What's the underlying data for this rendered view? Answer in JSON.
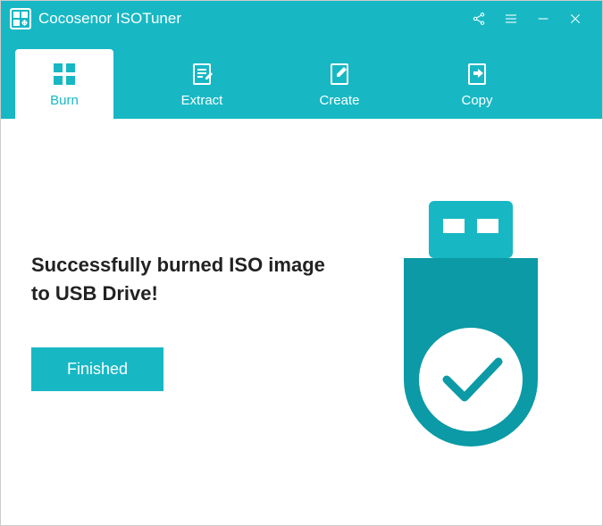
{
  "app": {
    "title": "Cocosenor ISOTuner"
  },
  "tabs": {
    "burn": "Burn",
    "extract": "Extract",
    "create": "Create",
    "copy": "Copy"
  },
  "main": {
    "message": "Successfully burned ISO image to USB Drive!",
    "finished_label": "Finished"
  },
  "colors": {
    "brand": "#17b8c4",
    "brand_dark": "#0b9aa6"
  }
}
